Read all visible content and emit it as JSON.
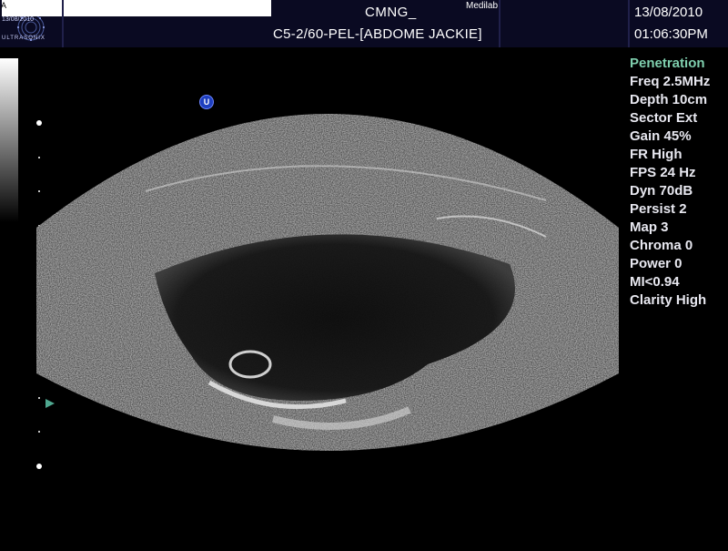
{
  "header": {
    "logo_brand": "ULTRASONIX",
    "logo_small_date": "13/08/2010",
    "logo_letter": "A",
    "center_title": "CMNG_",
    "brand_label": "Medilab",
    "probe_preset": "C5-2/60-PEL-[ABDOME JACKIE]",
    "date": "13/08/2010",
    "time": "01:06:30PM"
  },
  "orientation_marker": {
    "label": "U",
    "color": "#1e3fbf"
  },
  "params": {
    "mode": "Penetration",
    "items": [
      "Freq 2.5MHz",
      "Depth 10cm",
      "Sector Ext",
      "Gain 45%",
      "FR High",
      "FPS 24 Hz",
      "Dyn 70dB",
      "Persist 2",
      "Map 3",
      "Chroma 0",
      "Power 0",
      "MI<0.94",
      "Clarity High"
    ]
  },
  "colors": {
    "topbar_bg": "#0a0a22",
    "mode_text": "#7fcfae",
    "focus_marker": "#4fa890"
  },
  "icons": {
    "orientation": "probe-orientation-icon",
    "focus": "focus-arrow-icon"
  }
}
